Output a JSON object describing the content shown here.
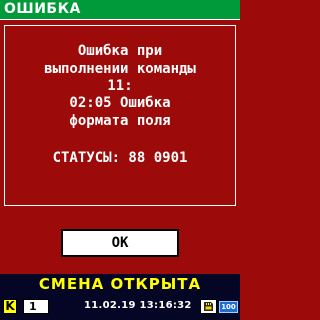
{
  "header": {
    "title": "ОШИБКА"
  },
  "dialog": {
    "message_lines": [
      "Ошибка при",
      "выполнении команды",
      "11:",
      "02:05 Ошибка",
      "формата поля"
    ],
    "status_line": "СТАТУСЫ: 88 0901",
    "ok_label": "OK"
  },
  "statusbar": {
    "shift_status": "СМЕНА ОТКРЫТА",
    "mode_letter": "K",
    "counter": "1",
    "datetime": "11.02.19 13:16:32",
    "storage_icon": "sd-card-icon",
    "battery_level": "100"
  },
  "colors": {
    "background": "#9c0a0a",
    "titlebar": "#009a3a",
    "status_bg": "#050526",
    "status_text": "#ffff00",
    "battery": "#1e6fd0"
  }
}
